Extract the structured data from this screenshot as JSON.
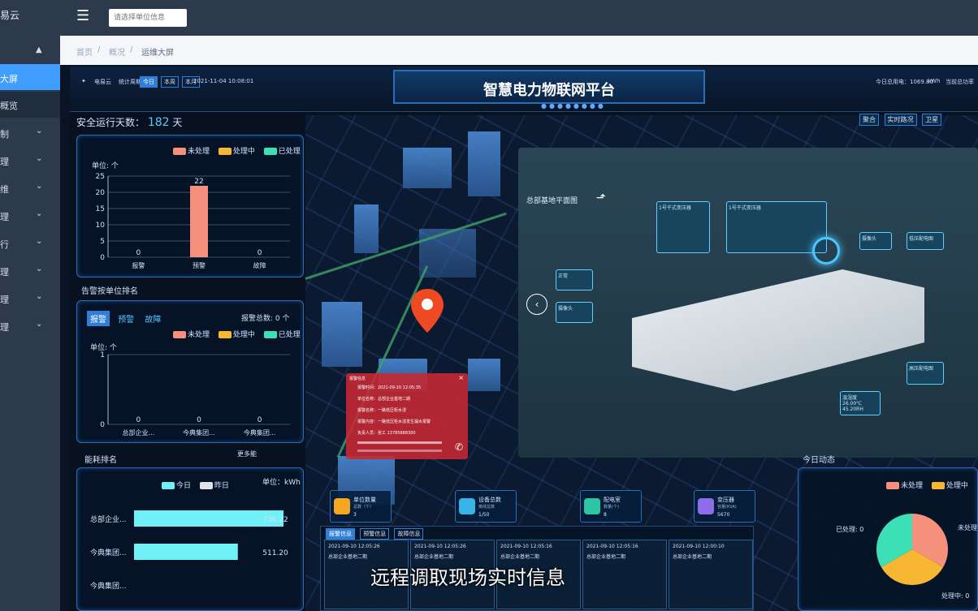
{
  "sidebar": {
    "brand": "易云",
    "active_item": "大屏",
    "item_overview": "概览",
    "item_3": "制",
    "item_4": "理",
    "item_5": "维",
    "item_6": "理",
    "item_7": "行",
    "item_8": "理",
    "item_9": "理",
    "item_10": "理"
  },
  "topbar": {
    "search_placeholder": "请选择单位信息"
  },
  "breadcrumb": {
    "home": "首页",
    "overview": "概况",
    "current": "运维大屏"
  },
  "dashboard": {
    "logo_text": "电易云",
    "stat_period_label": "统计周期",
    "period_today": "今日",
    "period_week": "本周",
    "period_month": "本月",
    "datetime": "2021-11-04 10:08:01",
    "title": "智慧电力物联网平台",
    "today_total_label": "今日总用电：1069.80",
    "today_total_unit": "kWh",
    "current_load_label": "当前总功率",
    "safe_days_label": "安全运行天数：",
    "safe_days_value": "182",
    "safe_days_unit": "天",
    "view_buttons": [
      "聚合",
      "实时路况",
      "卫星"
    ],
    "alarm_rank_title": "告警按单位排名",
    "energy_rank_title": "能耗排名",
    "energy_more": "更多能",
    "today_dynamic_title": "今日动态",
    "alarm_tabs": [
      "报警",
      "预警",
      "故障"
    ],
    "alarm_total": "报警总数: 0 个",
    "legend_unprocessed": "未处理",
    "legend_processing": "处理中",
    "legend_processed": "已处理",
    "unit_count_label": "单位: 个",
    "energy_unit_label": "单位：kWh",
    "energy_legend_today": "今日",
    "energy_legend_yesterday": "昨日"
  },
  "chart_data": [
    {
      "type": "bar",
      "title": "",
      "ylabel": "单位: 个",
      "categories": [
        "报警",
        "预警",
        "故障"
      ],
      "values": [
        0,
        22,
        0
      ],
      "ylim": [
        0,
        25
      ],
      "yticks": [
        0,
        5,
        10,
        15,
        20,
        25
      ],
      "series": [
        {
          "name": "未处理",
          "values": [
            0,
            22,
            0
          ]
        }
      ],
      "colors": {
        "bar": "#f4907c"
      }
    },
    {
      "type": "bar",
      "title": "",
      "ylabel": "单位: 个",
      "categories": [
        "总部企业...",
        "今典集团...",
        "今典集团..."
      ],
      "values": [
        0,
        0,
        0
      ],
      "ylim": [
        0,
        1
      ],
      "yticks": [
        0,
        1
      ]
    },
    {
      "type": "bar",
      "orientation": "horizontal",
      "categories": [
        "总部企业...",
        "今典集团...",
        "今典集团..."
      ],
      "series": [
        {
          "name": "今日",
          "values": [
            736.22,
            511.2,
            null
          ]
        }
      ],
      "value_labels": [
        "736.22",
        "511.20",
        ""
      ],
      "colors": {
        "today": "#6ff1f5",
        "yesterday": "#dfe3e8"
      }
    },
    {
      "type": "pie",
      "labels": [
        "未处理",
        "处理中",
        "已处理"
      ],
      "values": [
        1,
        1,
        1
      ],
      "colors": [
        "#f4907c",
        "#f7b733",
        "#3de0b6"
      ],
      "visible_labels": [
        "已处理: 0",
        "未处理",
        "处理中: 0"
      ]
    }
  ],
  "view3d": {
    "title": "总部基地平面图",
    "transformer1": "1号干式变压器",
    "transformer2": "1号干式变压器",
    "camera": "摄像头",
    "lowvolt": "低压配电图",
    "highvolt": "高压配电图",
    "status_label": "正常",
    "env_label": "温湿度",
    "env_temp": "26.00℃",
    "env_hum": "45.20RH"
  },
  "stats": [
    {
      "label": "单位数量",
      "sub": "总数（个）",
      "value": "3"
    },
    {
      "label": "设备总数",
      "sub": "离线总数",
      "value": "1/50"
    },
    {
      "label": "配电室",
      "sub": "数量(个)",
      "value": "8"
    },
    {
      "label": "变压器",
      "sub": "容量(KVA)",
      "value": "5670"
    }
  ],
  "alert_cards": {
    "tabs": [
      "报警信息",
      "预警信息",
      "故障信息"
    ],
    "items": [
      {
        "time": "2021-09-10 12:05:26",
        "unit": "总部企业基地二期"
      },
      {
        "time": "2021-09-10 12:05:26",
        "unit": "总部企业基地二期"
      },
      {
        "time": "2021-09-10 12:05:16",
        "unit": "总部企业基地二期"
      },
      {
        "time": "2021-09-10 12:05:16",
        "unit": "总部企业基地二期"
      },
      {
        "time": "2021-09-10 12:00:10",
        "unit": "总部企业基地二期"
      }
    ]
  },
  "popup": {
    "title": "报警信息",
    "time": "报警时间：2021-09-10 12:05:35",
    "unit": "单位名称：总部企业基地二期",
    "item": "报警名称：一路低压柜水浸",
    "content": "报警内容：一路低压柜水浸发生漏水报警",
    "person": "负责人员：张工 13785888300"
  },
  "caption": "远程调取现场实时信息"
}
